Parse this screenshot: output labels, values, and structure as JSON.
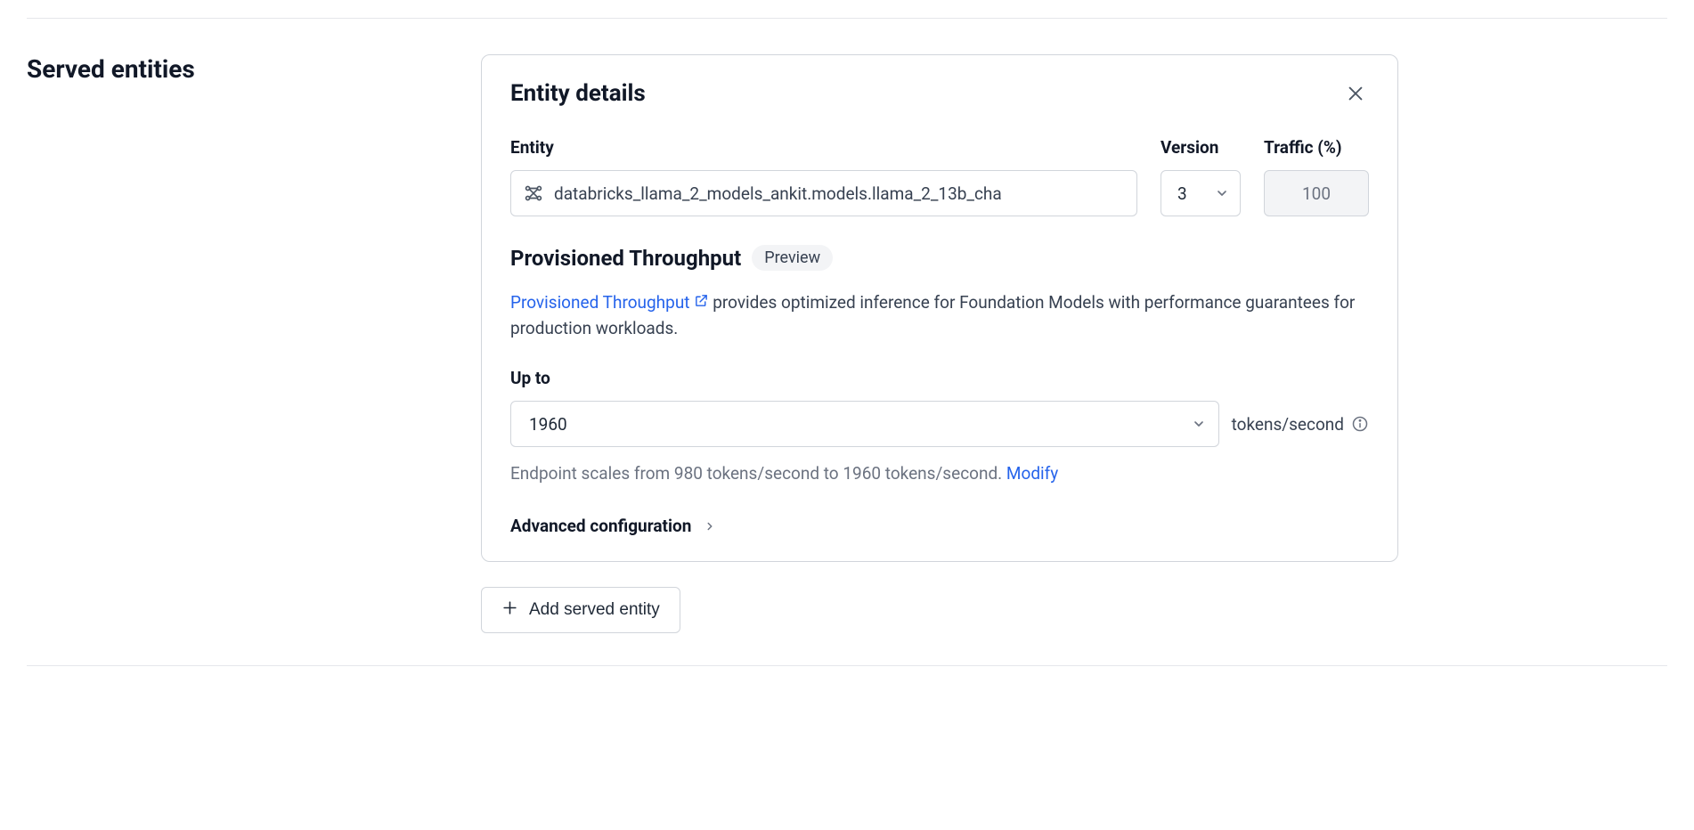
{
  "section": {
    "title": "Served entities"
  },
  "card": {
    "title": "Entity details",
    "fields": {
      "entity_label": "Entity",
      "version_label": "Version",
      "traffic_label": "Traffic (%)",
      "entity_value": "databricks_llama_2_models_ankit.models.llama_2_13b_cha",
      "version_value": "3",
      "traffic_value": "100"
    },
    "throughput": {
      "title": "Provisioned Throughput",
      "badge": "Preview",
      "link_text": "Provisioned Throughput",
      "description_tail": " provides optimized inference for Foundation Models with performance guarantees for production workloads.",
      "upto_label": "Up to",
      "upto_value": "1960",
      "unit": "tokens/second",
      "scale_text": "Endpoint scales from 980 tokens/second to 1960 tokens/second. ",
      "modify": "Modify"
    },
    "advanced": "Advanced configuration"
  },
  "add_button": "Add served entity"
}
